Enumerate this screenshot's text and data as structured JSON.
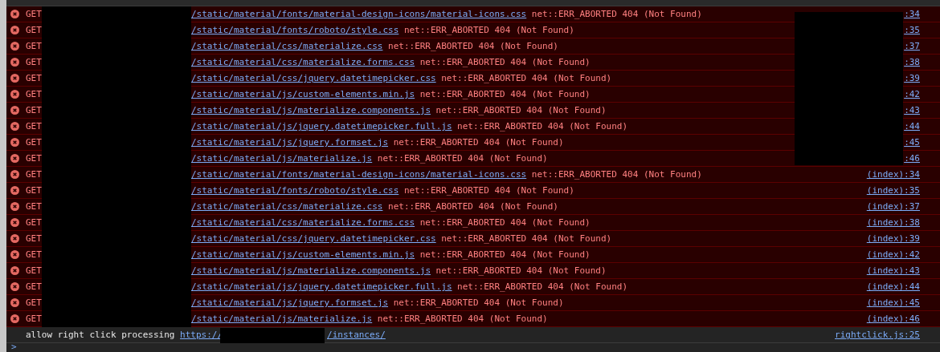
{
  "errors": [
    {
      "method": "GET",
      "url": "/static/material/fonts/material-design-icons/material-icons.css",
      "message": "net::ERR_ABORTED 404 (Not Found)",
      "source": ":34"
    },
    {
      "method": "GET",
      "url": "/static/material/fonts/roboto/style.css",
      "message": "net::ERR_ABORTED 404 (Not Found)",
      "source": ":35"
    },
    {
      "method": "GET",
      "url": "/static/material/css/materialize.css",
      "message": "net::ERR_ABORTED 404 (Not Found)",
      "source": ":37"
    },
    {
      "method": "GET",
      "url": "/static/material/css/materialize.forms.css",
      "message": "net::ERR_ABORTED 404 (Not Found)",
      "source": ":38"
    },
    {
      "method": "GET",
      "url": "/static/material/css/jquery.datetimepicker.css",
      "message": "net::ERR_ABORTED 404 (Not Found)",
      "source": ":39"
    },
    {
      "method": "GET",
      "url": "/static/material/js/custom-elements.min.js",
      "message": "net::ERR_ABORTED 404 (Not Found)",
      "source": ":42"
    },
    {
      "method": "GET",
      "url": "/static/material/js/materialize.components.js",
      "message": "net::ERR_ABORTED 404 (Not Found)",
      "source": ":43"
    },
    {
      "method": "GET",
      "url": "/static/material/js/jquery.datetimepicker.full.js",
      "message": "net::ERR_ABORTED 404 (Not Found)",
      "source": ":44"
    },
    {
      "method": "GET",
      "url": "/static/material/js/jquery.formset.js",
      "message": "net::ERR_ABORTED 404 (Not Found)",
      "source": ":45"
    },
    {
      "method": "GET",
      "url": "/static/material/js/materialize.js",
      "message": "net::ERR_ABORTED 404 (Not Found)",
      "source": ":46"
    },
    {
      "method": "GET",
      "url": "/static/material/fonts/material-design-icons/material-icons.css",
      "message": "net::ERR_ABORTED 404 (Not Found)",
      "source": "(index):34"
    },
    {
      "method": "GET",
      "url": "/static/material/fonts/roboto/style.css",
      "message": "net::ERR_ABORTED 404 (Not Found)",
      "source": "(index):35"
    },
    {
      "method": "GET",
      "url": "/static/material/css/materialize.css",
      "message": "net::ERR_ABORTED 404 (Not Found)",
      "source": "(index):37"
    },
    {
      "method": "GET",
      "url": "/static/material/css/materialize.forms.css",
      "message": "net::ERR_ABORTED 404 (Not Found)",
      "source": "(index):38"
    },
    {
      "method": "GET",
      "url": "/static/material/css/jquery.datetimepicker.css",
      "message": "net::ERR_ABORTED 404 (Not Found)",
      "source": "(index):39"
    },
    {
      "method": "GET",
      "url": "/static/material/js/custom-elements.min.js",
      "message": "net::ERR_ABORTED 404 (Not Found)",
      "source": "(index):42"
    },
    {
      "method": "GET",
      "url": "/static/material/js/materialize.components.js",
      "message": "net::ERR_ABORTED 404 (Not Found)",
      "source": "(index):43"
    },
    {
      "method": "GET",
      "url": "/static/material/js/jquery.datetimepicker.full.js",
      "message": "net::ERR_ABORTED 404 (Not Found)",
      "source": "(index):44"
    },
    {
      "method": "GET",
      "url": "/static/material/js/jquery.formset.js",
      "message": "net::ERR_ABORTED 404 (Not Found)",
      "source": "(index):45"
    },
    {
      "method": "GET",
      "url": "/static/material/js/materialize.js",
      "message": "net::ERR_ABORTED 404 (Not Found)",
      "source": "(index):46"
    }
  ],
  "log": {
    "text": "allow right click processing",
    "url_start": "https://",
    "url_end": "/instances/",
    "source": "rightclick.js:25"
  },
  "prompt": {
    "symbol": ">"
  }
}
